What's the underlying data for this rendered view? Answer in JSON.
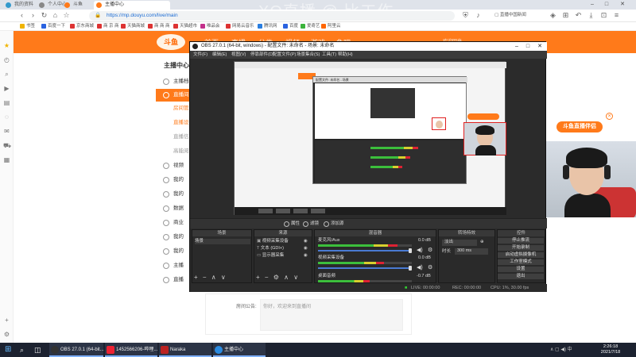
{
  "browser": {
    "tabs": [
      {
        "label": "我的资料"
      },
      {
        "label": "个人中心"
      },
      {
        "label": "斗鱼"
      },
      {
        "label": "主播中心"
      }
    ],
    "url": "https://mp.douyu.com/live/main",
    "bookmarks": [
      "书签",
      "百度一下",
      "京东商城",
      "商 京 商",
      "天猫商城",
      "商 商 商",
      "天猫超市",
      "唯品会",
      "网易云音乐",
      "腾讯网",
      "百度",
      "爱奇艺",
      "阿里云"
    ],
    "watermark": "XQ直播 @ 比工作"
  },
  "site": {
    "logo": "斗鱼",
    "nav": [
      "首页",
      "直播",
      "分类",
      "视频",
      "游戏",
      "鱼吧"
    ],
    "header_user": "欢迎回来"
  },
  "sidebar": {
    "title": "主播中心",
    "items": [
      {
        "label": "主播档",
        "type": "item"
      },
      {
        "label": "直播间",
        "type": "active"
      },
      {
        "label": "房间管",
        "type": "sub"
      },
      {
        "label": "直播设",
        "type": "sub"
      },
      {
        "label": "直播信",
        "type": "sub"
      },
      {
        "label": "高能阅",
        "type": "sub"
      },
      {
        "label": "视频",
        "type": "item"
      },
      {
        "label": "我的",
        "type": "item"
      },
      {
        "label": "我的",
        "type": "item"
      },
      {
        "label": "数据",
        "type": "item"
      },
      {
        "label": "商业",
        "type": "item"
      },
      {
        "label": "我的",
        "type": "item"
      },
      {
        "label": "我的",
        "type": "item"
      },
      {
        "label": "主播",
        "type": "item"
      },
      {
        "label": "直播",
        "type": "item"
      }
    ]
  },
  "announcement": {
    "label": "房间公告:",
    "placeholder": "你好，欢迎来到直播间"
  },
  "promo_badge": "斗鱼直播伴侣",
  "obs": {
    "title": "OBS 27.0.1 (64-bit, windows) - 配置文件: 未命名 - 场景: 未命名",
    "menu": [
      "文件(F)",
      "编辑(E)",
      "视图(V)",
      "停靠部件(D)",
      "配置文件(P)",
      "场景集合(S)",
      "工具(T)",
      "帮助(H)"
    ],
    "source_toolbar": [
      "属性",
      "滤镜",
      "添加源"
    ],
    "scenes": {
      "header": "场景",
      "items": [
        "场景"
      ]
    },
    "sources": {
      "header": "来源",
      "items": [
        "视频采集设备",
        "文本 (GDI+)",
        "显示器采集"
      ]
    },
    "mixer": {
      "header": "混音器",
      "tracks": [
        {
          "name": "麦克风/Aux",
          "db": "0.0 dB",
          "level": 0.85
        },
        {
          "name": "视频采集设备",
          "db": "0.0 dB",
          "level": 0.7
        },
        {
          "name": "桌面音频",
          "db": "-0.7 dB",
          "level": 0.55
        }
      ]
    },
    "transitions": {
      "header": "转场特效",
      "fade": "淡出",
      "duration_label": "时长",
      "duration": "300 ms"
    },
    "controls": {
      "header": "控件",
      "buttons": [
        "停止推流",
        "开始录制",
        "启动虚拟摄像机",
        "工作室模式",
        "设置",
        "退出"
      ]
    },
    "status": {
      "live": "LIVE: 00:00:00",
      "rec": "REC: 00:00:00",
      "cpu": "CPU: 1%, 30.00 fps"
    },
    "inner_dialog_title": "配置文件: 未命名 - 场景"
  },
  "taskbar": {
    "items": [
      {
        "label": "OBS 27.0.1 (64-bit..."
      },
      {
        "label": "1452566206-哔哩..."
      },
      {
        "label": "Naraka"
      },
      {
        "label": "主播中心"
      }
    ],
    "time": "2:26:18",
    "date": "2021/7/18"
  },
  "colors": {
    "accent": "#ff7a1a",
    "obs_bg": "#2b2b2b",
    "taskbar": "#1c2230"
  }
}
